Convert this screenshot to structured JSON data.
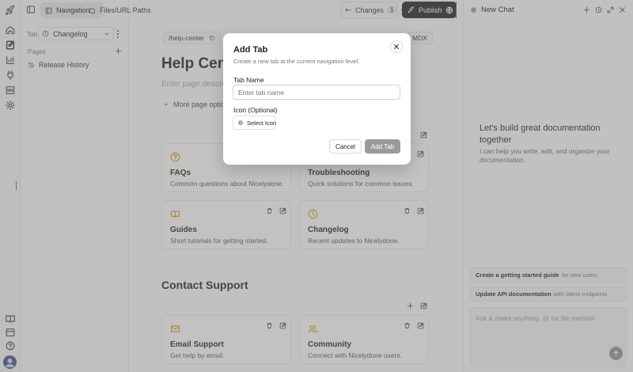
{
  "topbar": {
    "nav_tab": "Navigation",
    "files_tab": "Files/URL Paths",
    "changes_label": "Changes",
    "changes_count": "1",
    "publish_label": "Publish"
  },
  "sidebar": {
    "tab_label": "Tab",
    "tab_select_value": "Changelog",
    "pages_label": "Pages",
    "pages": [
      {
        "label": "Release History"
      }
    ]
  },
  "main": {
    "path": "/help-center",
    "mdx_label": "MDX",
    "title": "Help Center",
    "description_placeholder": "Enter page description",
    "more_options": "More page options",
    "cards": [
      {
        "title": "FAQs",
        "desc": "Common questions about Nicelydone.",
        "icon": "question-circle-icon"
      },
      {
        "title": "Troubleshooting",
        "desc": "Quick solutions for common issues.",
        "icon": "wrench-icon"
      },
      {
        "title": "Guides",
        "desc": "Short tutorials for getting started.",
        "icon": "book-icon"
      },
      {
        "title": "Changelog",
        "desc": "Recent updates to Nicelydone.",
        "icon": "clock-icon"
      }
    ],
    "contact_title": "Contact Support",
    "contact_cards": [
      {
        "title": "Email Support",
        "desc": "Get help by email.",
        "icon": "mail-icon"
      },
      {
        "title": "Community",
        "desc": "Connect with Nicelydone users.",
        "icon": "users-icon"
      }
    ]
  },
  "right_panel": {
    "title": "New Chat",
    "heading": "Let's build great documentation together",
    "sub": "I can help you write, edit, and organize your documentation.",
    "suggestions": [
      {
        "bold": "Create a getting started guide",
        "rest": "for new users"
      },
      {
        "bold": "Update API documentation",
        "rest": "with latest endpoints"
      }
    ],
    "input_placeholder": "Ask & make anything, @ for file mention"
  },
  "modal": {
    "title": "Add Tab",
    "subtitle": "Create a new tab at the current navigation level.",
    "name_label": "Tab Name",
    "name_placeholder": "Enter tab name",
    "name_value": "",
    "icon_label": "Icon (Optional)",
    "select_icon": "Select Icon",
    "cancel": "Cancel",
    "submit": "Add Tab"
  },
  "colors": {
    "accent_icon": "#d79a2a",
    "publish_bg": "#1f1f1f",
    "submit_disabled_bg": "#9b9b9b"
  }
}
